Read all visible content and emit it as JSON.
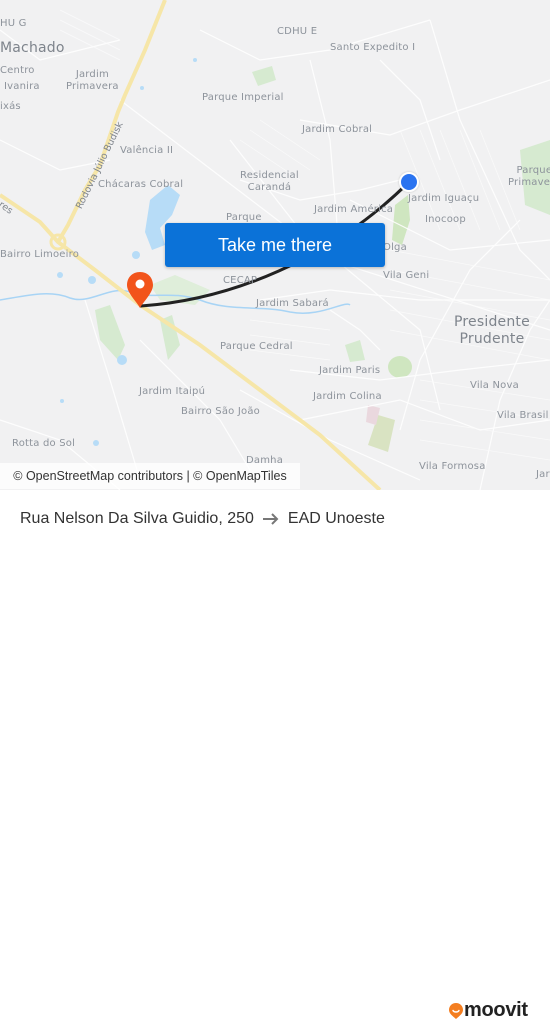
{
  "map": {
    "labels": [
      {
        "id": "cdhu-g",
        "text": "HU G"
      },
      {
        "id": "machado",
        "text": "Machado"
      },
      {
        "id": "centro",
        "text": "Centro"
      },
      {
        "id": "ivanira",
        "text": "Ivanira"
      },
      {
        "id": "ixas",
        "text": "ixás"
      },
      {
        "id": "jardim-primavera",
        "text": "Jardim\nPrimavera"
      },
      {
        "id": "cdhu-e",
        "text": "CDHU E"
      },
      {
        "id": "santo-expedito",
        "text": "Santo Expedito I"
      },
      {
        "id": "parque-imperial",
        "text": "Parque Imperial"
      },
      {
        "id": "jardim-cobral",
        "text": "Jardim Cobral"
      },
      {
        "id": "valencia",
        "text": "Valência II"
      },
      {
        "id": "residencial-caranda",
        "text": "Residencial\nCarandá"
      },
      {
        "id": "chacaras-cobral",
        "text": "Chácaras Cobral"
      },
      {
        "id": "parque-primavera",
        "text": "Parque\nPrimavera"
      },
      {
        "id": "jardim-iguacu",
        "text": "Jardim Iguaçu"
      },
      {
        "id": "jardim-america",
        "text": "Jardim América"
      },
      {
        "id": "inocoop",
        "text": "Inocoop"
      },
      {
        "id": "parque",
        "text": "Parque"
      },
      {
        "id": "olga",
        "text": "Olga"
      },
      {
        "id": "bairro-limoeiro",
        "text": "Bairro Limoeiro"
      },
      {
        "id": "cecap",
        "text": "CECAP"
      },
      {
        "id": "vila-geni",
        "text": "Vila Geni"
      },
      {
        "id": "jardim-sabara",
        "text": "Jardim Sabará"
      },
      {
        "id": "presidente-prudente",
        "text": "Presidente\nPrudente"
      },
      {
        "id": "parque-cedral",
        "text": "Parque Cedral"
      },
      {
        "id": "jardim-paris",
        "text": "Jardim Paris"
      },
      {
        "id": "jardim-itaipu",
        "text": "Jardim Itaipú"
      },
      {
        "id": "jardim-colina",
        "text": "Jardim Colina"
      },
      {
        "id": "vila-nova",
        "text": "Vila Nova"
      },
      {
        "id": "bairro-sao-joao",
        "text": "Bairro São João"
      },
      {
        "id": "vila-brasil",
        "text": "Vila Brasil"
      },
      {
        "id": "rotta-do-sol",
        "text": "Rotta do Sol"
      },
      {
        "id": "damha",
        "text": "Damha"
      },
      {
        "id": "vila-formosa",
        "text": "Vila Formosa"
      },
      {
        "id": "jar",
        "text": "Jar"
      }
    ],
    "road_labels": {
      "rodovia": "Rodovia Júlio Budisk",
      "ares": "ares"
    },
    "cta_label": "Take me there",
    "attribution": "© OpenStreetMap contributors | © OpenMapTiles",
    "colors": {
      "route": "#222222",
      "origin": "#2b74f0",
      "destination": "#f2541b",
      "cta": "#0b72d8",
      "highway": "#f7e3a0",
      "water": "#a8d4f5",
      "park": "#cfe6c0"
    }
  },
  "footer": {
    "origin": "Rua Nelson Da Silva Guidio, 250",
    "destination": "EAD Unoeste",
    "logo_text": "moovit"
  }
}
